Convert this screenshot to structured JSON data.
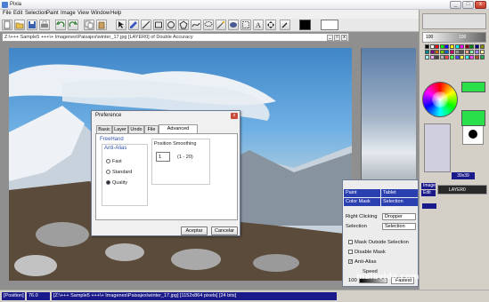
{
  "app": {
    "title": "Pixia"
  },
  "window_controls": {
    "minimize": "_",
    "maximize": "□",
    "close": "x"
  },
  "menu": [
    "File",
    "Edit",
    "Selection",
    "Paint",
    "Image",
    "View",
    "Window",
    "Help"
  ],
  "document": {
    "title": "Z:\\+++ Sample5 +++\\+ Imagenes\\Paisajes\\winter_17.jpg [LAYER0] of Double Accuracy",
    "controls": [
      "_",
      "□",
      "x"
    ]
  },
  "preference_dialog": {
    "title": "Preference",
    "close": "x",
    "tabs": [
      "Basic",
      "Layer",
      "Undo",
      "File",
      "Advanced Option"
    ],
    "active_tab": "Advanced Option",
    "group": "FreeHand",
    "antialias_label": "Anti-Alias",
    "antialias_options": [
      "Fast",
      "Standard",
      "Quality"
    ],
    "antialias_selected": "Quality",
    "smoothing_label": "Position Smoothing",
    "smoothing_value": "1",
    "smoothing_range": "(1 - 20)",
    "ok_label": "Aceptar",
    "cancel_label": "Cancelar"
  },
  "tablet_panel": {
    "header_cells": [
      "Paint",
      "Tablet",
      "Color Mask",
      "Selection History"
    ],
    "right_clicking_label": "Right Clicking",
    "right_clicking_value": "Dropper",
    "selection_label": "Selection",
    "selection_value": "Selection",
    "mask_outside_label": "Mask Outside Selection",
    "disable_mask_label": "Disable Mask",
    "antialias_label": "Anti-Alias",
    "antialias_checked": true,
    "speed_label": "Speed",
    "speed_value": "100",
    "fastest_label": "Fastest"
  },
  "right_panel": {
    "brush_size_values": [
      "100",
      "100"
    ],
    "zoom_readout": "39x39",
    "layer_tabs": [
      "Image",
      "Edit"
    ],
    "layer_name": "LAYER0"
  },
  "status_bar": {
    "position_label": "[Position]",
    "zoom": "76.0",
    "path": "[Z:\\+++ Sample5 +++\\+ Imagenes\\Paisajes\\winter_17.jpg] [1152x864 pixels] [24 bits]"
  },
  "watermark": "malavida.com",
  "colors": {
    "selection_blue": "#1a1a8a",
    "accent": "#2a3fb0"
  }
}
